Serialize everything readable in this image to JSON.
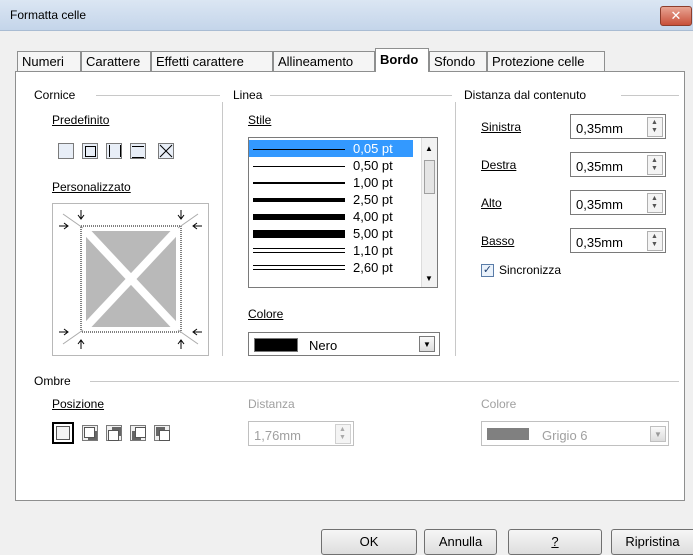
{
  "window": {
    "title": "Formatta celle",
    "close_glyph": "✕"
  },
  "tabs": [
    {
      "label": "Numeri"
    },
    {
      "label": "Carattere"
    },
    {
      "label": "Effetti carattere"
    },
    {
      "label": "Allineamento"
    },
    {
      "label": "Bordo",
      "active": true
    },
    {
      "label": "Sfondo"
    },
    {
      "label": "Protezione celle"
    }
  ],
  "cornice": {
    "legend": "Cornice",
    "predefinito_label": "Predefinito",
    "personalizzato_label": "Personalizzato"
  },
  "linea": {
    "legend": "Linea",
    "stile_label": "Stile",
    "styles": [
      "0,05 pt",
      "0,50 pt",
      "1,00 pt",
      "2,50 pt",
      "4,00 pt",
      "5,00 pt",
      "1,10 pt",
      "2,60 pt"
    ],
    "selected_index": 0,
    "colore_label": "Colore",
    "colore_value": "Nero",
    "colore_swatch": "#000000"
  },
  "distanza": {
    "legend": "Distanza dal contenuto",
    "sinistra_label": "Sinistra",
    "sinistra_value": "0,35mm",
    "destra_label": "Destra",
    "destra_value": "0,35mm",
    "alto_label": "Alto",
    "alto_value": "0,35mm",
    "basso_label": "Basso",
    "basso_value": "0,35mm",
    "sincronizza_label": "Sincronizza",
    "sincronizza_checked": true
  },
  "ombre": {
    "legend": "Ombre",
    "posizione_label": "Posizione",
    "distanza_label": "Distanza",
    "distanza_value": "1,76mm",
    "colore_label": "Colore",
    "colore_value": "Grigio 6",
    "colore_swatch": "#808080"
  },
  "buttons": {
    "ok": "OK",
    "annulla": "Annulla",
    "help": "?",
    "ripristina": "Ripristina"
  }
}
